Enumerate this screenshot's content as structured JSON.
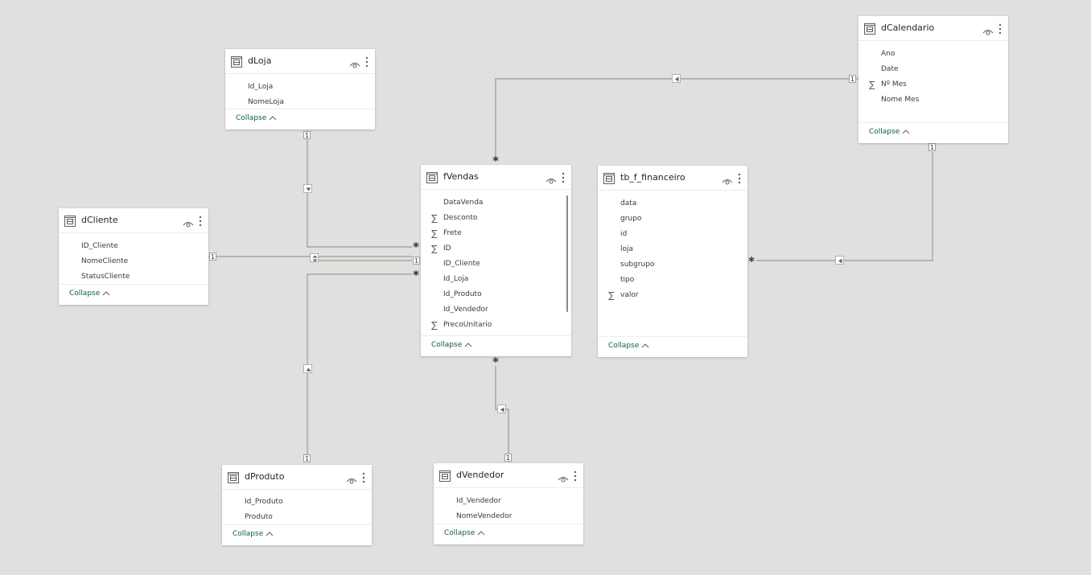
{
  "tables": {
    "dLoja": {
      "title": "dLoja",
      "fields": [
        {
          "name": "Id_Loja",
          "sum": false
        },
        {
          "name": "NomeLoja",
          "sum": false
        }
      ],
      "collapse_label": "Collapse"
    },
    "dCalendario": {
      "title": "dCalendario",
      "fields": [
        {
          "name": "Ano",
          "sum": false
        },
        {
          "name": "Date",
          "sum": false
        },
        {
          "name": "Nº Mes",
          "sum": true
        },
        {
          "name": "Nome Mes",
          "sum": false
        }
      ],
      "collapse_label": "Collapse"
    },
    "fVendas": {
      "title": "fVendas",
      "fields": [
        {
          "name": "DataVenda",
          "sum": false
        },
        {
          "name": "Desconto",
          "sum": true
        },
        {
          "name": "Frete",
          "sum": true
        },
        {
          "name": "ID",
          "sum": true
        },
        {
          "name": "ID_Cliente",
          "sum": false
        },
        {
          "name": "Id_Loja",
          "sum": false
        },
        {
          "name": "Id_Produto",
          "sum": false
        },
        {
          "name": "Id_Vendedor",
          "sum": false
        },
        {
          "name": "PrecoUnitario",
          "sum": true
        }
      ],
      "collapse_label": "Collapse"
    },
    "tb_f_financeiro": {
      "title": "tb_f_financeiro",
      "fields": [
        {
          "name": "data",
          "sum": false
        },
        {
          "name": "grupo",
          "sum": false
        },
        {
          "name": "id",
          "sum": false
        },
        {
          "name": "loja",
          "sum": false
        },
        {
          "name": "subgrupo",
          "sum": false
        },
        {
          "name": "tipo",
          "sum": false
        },
        {
          "name": "valor",
          "sum": true
        }
      ],
      "collapse_label": "Collapse"
    },
    "dCliente": {
      "title": "dCliente",
      "fields": [
        {
          "name": "ID_Cliente",
          "sum": false
        },
        {
          "name": "NomeCliente",
          "sum": false
        },
        {
          "name": "StatusCliente",
          "sum": false
        }
      ],
      "collapse_label": "Collapse"
    },
    "dProduto": {
      "title": "dProduto",
      "fields": [
        {
          "name": "Id_Produto",
          "sum": false
        },
        {
          "name": "Produto",
          "sum": false
        }
      ],
      "collapse_label": "Collapse"
    },
    "dVendedor": {
      "title": "dVendedor",
      "fields": [
        {
          "name": "Id_Vendedor",
          "sum": false
        },
        {
          "name": "NomeVendedor",
          "sum": false
        }
      ],
      "collapse_label": "Collapse"
    }
  },
  "icons": {
    "sum": "∑",
    "visibility": "eye-icon",
    "more_options": "more-options-icon",
    "table": "table-icon",
    "collapse": "chevron-up-icon"
  },
  "relationships": [
    {
      "name": "dloja-fvendas",
      "from": "dLoja",
      "to": "fVendas",
      "from_card": "1",
      "to_card": "*",
      "direction": "single"
    },
    {
      "name": "dcalendario-fvendas",
      "from": "dCalendario",
      "to": "fVendas",
      "from_card": "1",
      "to_card": "*",
      "direction": "single"
    },
    {
      "name": "dcliente-fvendas",
      "from": "dCliente",
      "to": "fVendas",
      "from_card": "1",
      "to_card": "1",
      "direction": "both"
    },
    {
      "name": "dproduto-fvendas",
      "from": "dProduto",
      "to": "fVendas",
      "from_card": "1",
      "to_card": "*",
      "direction": "single"
    },
    {
      "name": "dvendedor-fvendas",
      "from": "dVendedor",
      "to": "fVendas",
      "from_card": "1",
      "to_card": "*",
      "direction": "single"
    },
    {
      "name": "dcalendario-financeiro",
      "from": "dCalendario",
      "to": "tb_f_financeiro",
      "from_card": "1",
      "to_card": "*",
      "direction": "single"
    }
  ],
  "colors": {
    "canvas": "#e1e0df",
    "card": "#ffffff",
    "line": "#9b9997",
    "collapse_text": "#0f5b4b",
    "text": "#252423"
  }
}
